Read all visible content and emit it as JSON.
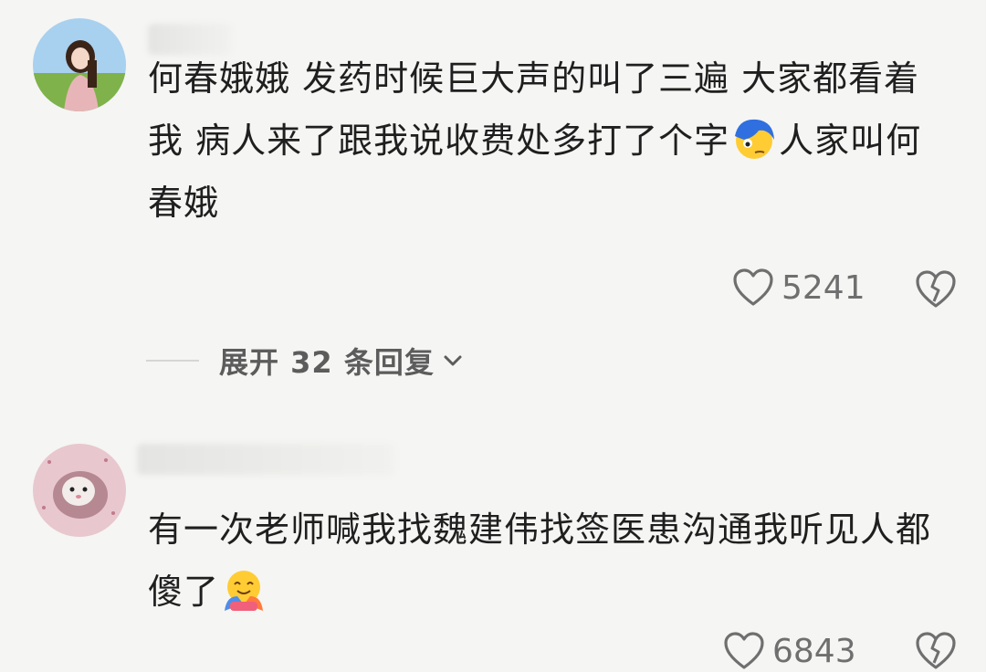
{
  "comments": [
    {
      "text_before": "何春娥娥 发药时候巨大声的叫了三遍 大家都看着我 病人来了跟我说收费处多打了个字",
      "text_after": "人家叫何春娥",
      "emoji": "face-with-hair-over-eye-emoji",
      "likes": "5241"
    },
    {
      "text_before": "有一次老师喊我找魏建伟找签医患沟通我听见人都傻了",
      "text_after": "",
      "emoji": "hugging-face-emoji",
      "likes": "6843"
    }
  ],
  "replies": {
    "label": "展开 32 条回复"
  },
  "colors": {
    "background": "#f5f5f3",
    "text": "#1f1f1f",
    "muted": "#6f6f6f"
  }
}
